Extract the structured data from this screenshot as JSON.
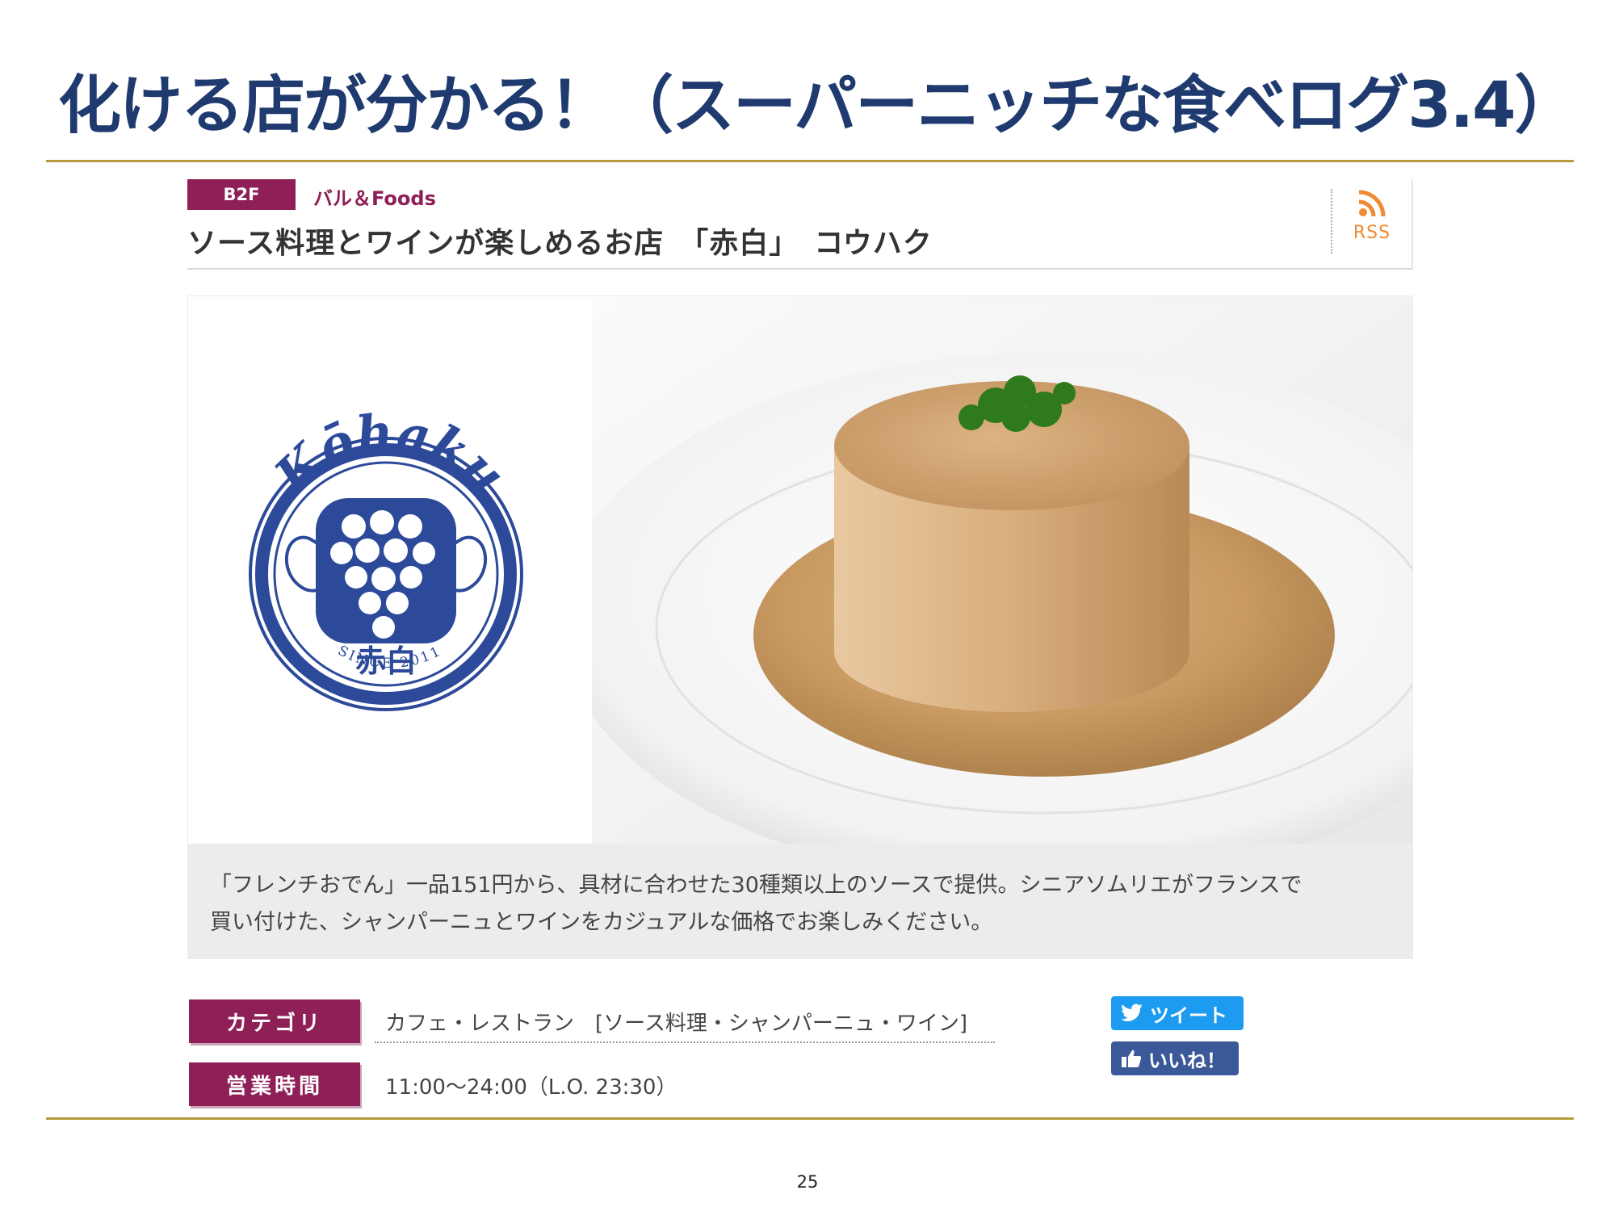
{
  "slide": {
    "title": "化ける店が分かる！（スーパーニッチな食べログ3.4）",
    "page_number": "25"
  },
  "shop": {
    "floor": "B2F",
    "category_tag": "バル＆Foods",
    "name": "ソース料理とワインが楽しめるお店　「赤白」　コウハク",
    "rss_label": "RSS",
    "logo": {
      "script_text": "Kōhaku",
      "kanji": "赤白",
      "since_text": "SINCE 2011"
    },
    "description_lines": [
      "「フレンチおでん」一品151円から、具材に合わせた30種類以上のソースで提供。シニアソムリエがフランスで",
      "買い付けた、シャンパーニュとワインをカジュアルな価格でお楽しみください。"
    ],
    "info": [
      {
        "label": "カテゴリ",
        "value": "カフェ・レストラン　[ソース料理・シャンパーニュ・ワイン]"
      },
      {
        "label": "営業時間",
        "value": "11:00～24:00（L.O. 23:30）"
      }
    ],
    "social": {
      "tweet_label": "ツイート",
      "like_label": "いいね！"
    }
  },
  "colors": {
    "title_blue": "#1f3a6e",
    "rule_gold": "#b8993e",
    "label_magenta": "#8e1f57",
    "rss_orange": "#f08a33",
    "twitter_blue": "#1d9bf0",
    "facebook_blue": "#3b5998"
  },
  "icons": [
    "rss-icon",
    "twitter-bird-icon",
    "thumbs-up-icon",
    "grape-icon"
  ]
}
